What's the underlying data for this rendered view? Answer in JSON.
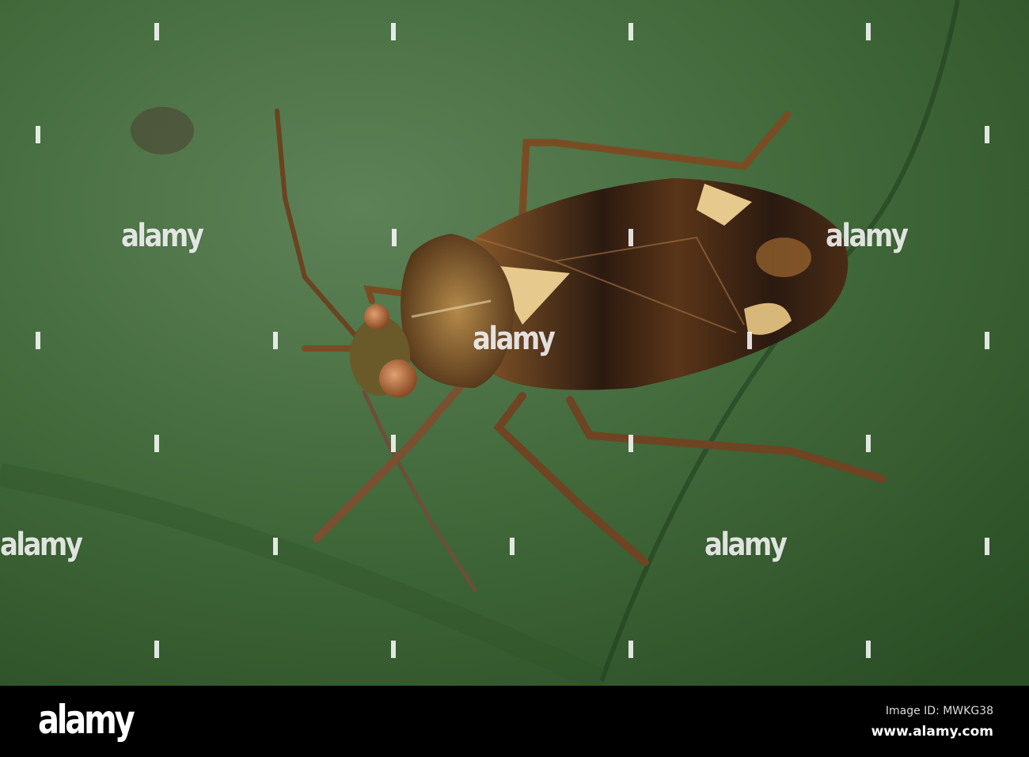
{
  "photo": {
    "subject": "mirid bug on green leaf",
    "colors": {
      "leaf": "#3f6a36",
      "leaf_dark": "#2c4f27",
      "bug_dark": "#2a1a10",
      "bug_light": "#e6c98c",
      "bug_brown": "#7a4a22"
    }
  },
  "watermark": {
    "text": "alamy"
  },
  "footer": {
    "logo": "alamy",
    "image_id": "Image ID: MWKG38",
    "url": "www.alamy.com"
  }
}
